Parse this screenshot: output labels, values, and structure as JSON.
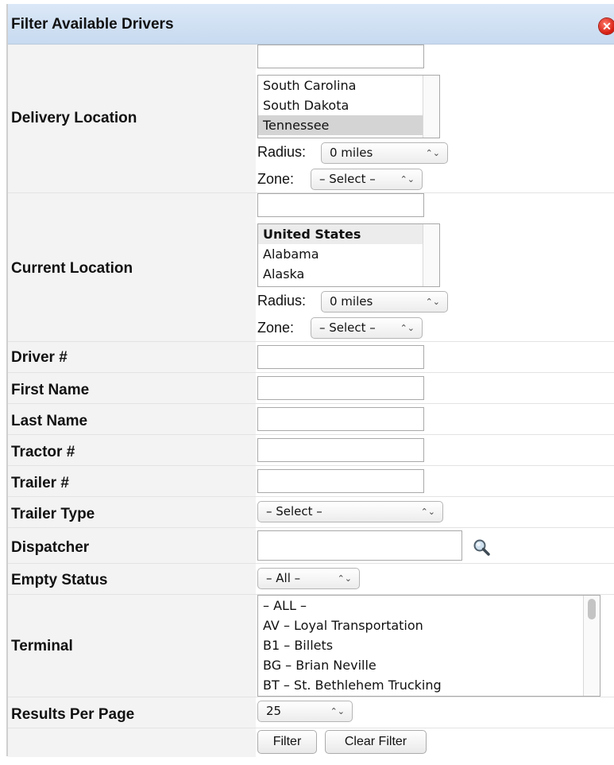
{
  "header": {
    "title": "Filter Available Drivers",
    "close_glyph": "✕"
  },
  "delivery": {
    "label": "Delivery Location",
    "options": [
      "South Carolina",
      "South Dakota",
      "Tennessee"
    ],
    "radius_label": "Radius:",
    "radius_value": "0 miles",
    "zone_label": "Zone:",
    "zone_value": "– Select –"
  },
  "current": {
    "label": "Current Location",
    "options": [
      "United States",
      "Alabama",
      "Alaska"
    ],
    "radius_label": "Radius:",
    "radius_value": "0 miles",
    "zone_label": "Zone:",
    "zone_value": "– Select –"
  },
  "fields": {
    "driver": "Driver #",
    "first_name": "First Name",
    "last_name": "Last Name",
    "tractor": "Tractor #",
    "trailer": "Trailer #",
    "trailer_type": "Trailer Type",
    "trailer_type_value": "– Select –",
    "dispatcher": "Dispatcher",
    "empty_status": "Empty Status",
    "empty_status_value": "– All –",
    "terminal": "Terminal",
    "results_per_page": "Results Per Page",
    "results_per_page_value": "25"
  },
  "terminal_options": [
    "– ALL –",
    "AV – Loyal Transportation",
    "B1 – Billets",
    "BG – Brian Neville",
    "BT – St. Bethlehem Trucking"
  ],
  "buttons": {
    "filter": "Filter",
    "clear": "Clear Filter"
  },
  "arrows": "⌃⌄",
  "colors": {
    "header_bg": "#c7daf0",
    "close": "#d41a0e",
    "selected_option": "#d4d4d4"
  },
  "icons": {
    "close": "close-icon",
    "search": "magnifier-icon"
  }
}
